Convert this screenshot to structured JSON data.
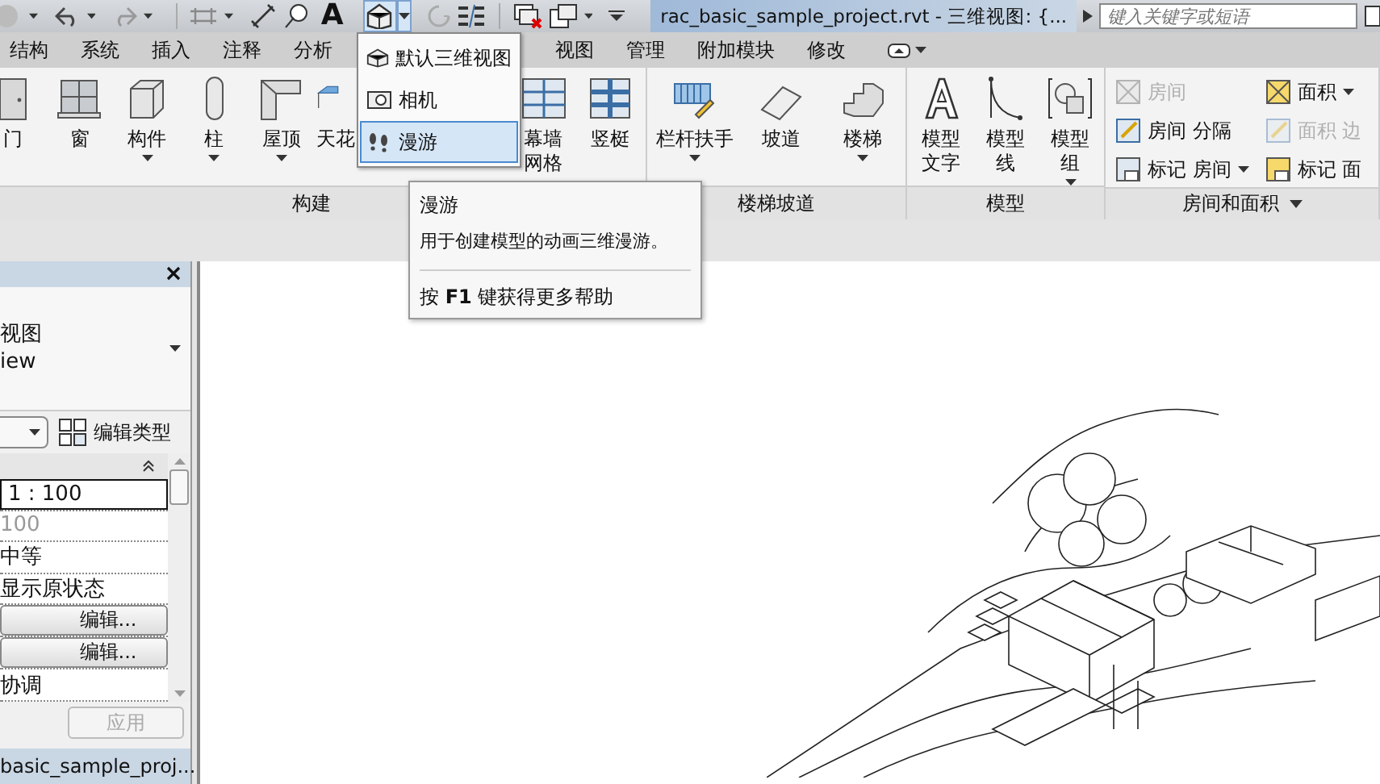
{
  "quick_access": {
    "text_tool": "A",
    "title": "rac_basic_sample_project.rvt - 三维视图: {...",
    "search": {
      "placeholder": "键入关键字或短语"
    }
  },
  "tabs": [
    {
      "label": "结构",
      "selected": false
    },
    {
      "label": "系统",
      "selected": false
    },
    {
      "label": "插入",
      "selected": false
    },
    {
      "label": "注释",
      "selected": false
    },
    {
      "label": "分析",
      "selected": false
    },
    {
      "label": "视图",
      "selected": false
    },
    {
      "label": "管理",
      "selected": false
    },
    {
      "label": "附加模块",
      "selected": false
    },
    {
      "label": "修改",
      "selected": false
    }
  ],
  "ribbon_panels": [
    {
      "title": "构建",
      "has_menu": false,
      "buttons": [
        {
          "label": "门",
          "has_menu": false
        },
        {
          "label": "窗",
          "has_menu": false
        },
        {
          "label": "构件",
          "has_menu": true
        },
        {
          "label": "柱",
          "has_menu": true
        },
        {
          "label": "屋顶",
          "has_menu": true
        },
        {
          "label": "天花",
          "has_menu": false
        },
        {
          "label": "幕墙网格",
          "has_menu": false
        },
        {
          "label": "竖梃",
          "has_menu": false
        }
      ]
    },
    {
      "title": "楼梯坡道",
      "has_menu": false,
      "buttons": [
        {
          "label": "栏杆扶手",
          "has_menu": true
        },
        {
          "label": "坡道",
          "has_menu": false
        },
        {
          "label": "楼梯",
          "has_menu": true
        }
      ]
    },
    {
      "title": "模型",
      "has_menu": false,
      "buttons": [
        {
          "label": "模型文字",
          "has_menu": false
        },
        {
          "label": "模型线",
          "has_menu": false
        },
        {
          "label": "模型组",
          "has_menu": true
        }
      ]
    },
    {
      "title": "房间和面积",
      "has_menu": true,
      "small_columns": [
        [
          {
            "label": "房间",
            "disabled": true,
            "has_menu": false
          },
          {
            "label": "房间 分隔",
            "disabled": false,
            "has_menu": false
          },
          {
            "label": "标记 房间",
            "disabled": false,
            "has_menu": true
          }
        ],
        [
          {
            "label": "面积",
            "disabled": false,
            "has_menu": true
          },
          {
            "label": "面积 边",
            "disabled": true,
            "has_menu": false
          },
          {
            "label": "标记 面",
            "disabled": false,
            "has_menu": false
          }
        ]
      ]
    }
  ],
  "view_menu": {
    "items": [
      {
        "label": "默认三维视图",
        "selected": false
      },
      {
        "label": "相机",
        "selected": false
      },
      {
        "label": "漫游",
        "selected": true
      }
    ]
  },
  "tooltip": {
    "title": "漫游",
    "description": "用于创建模型的动画三维漫游。",
    "help": "按 **F1** 键获得更多帮助"
  },
  "properties": {
    "type_name": "视图",
    "type_subname": "iew",
    "edit_type_button": "编辑类型",
    "rows": [
      {
        "kind": "input",
        "value": "1 : 100",
        "disabled": false
      },
      {
        "kind": "text",
        "value": "100",
        "disabled": true
      },
      {
        "kind": "text",
        "value": "中等",
        "disabled": false
      },
      {
        "kind": "text",
        "value": "显示原状态",
        "disabled": false
      },
      {
        "kind": "button",
        "value": "编辑...",
        "disabled": false
      },
      {
        "kind": "button",
        "value": "编辑...",
        "disabled": false
      },
      {
        "kind": "text",
        "value": "协调",
        "disabled": false
      }
    ],
    "apply_button": {
      "label": "应用",
      "disabled": true
    }
  },
  "project_browser": {
    "title": "basic_sample_proj..."
  }
}
